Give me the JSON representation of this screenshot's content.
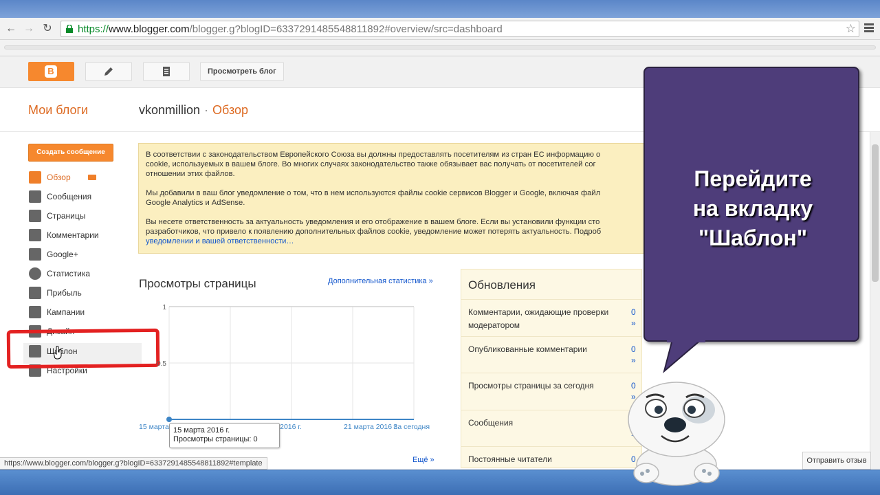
{
  "browser": {
    "url_scheme": "https://",
    "url_host": "www.blogger.com",
    "url_path": "/blogger.g?blogID=6337291485548811892#overview/src=dashboard",
    "back_icon": "arrow-left-icon",
    "forward_icon": "arrow-right-icon",
    "reload_icon": "reload-icon",
    "star_icon": "star-icon"
  },
  "header": {
    "view_blog_label": "Просмотреть блог",
    "my_blogs_label": "Мои блоги",
    "blog_name": "vkonmillion",
    "separator": "·",
    "section": "Обзор"
  },
  "sidebar": {
    "create_post_label": "Создать сообщение",
    "items": [
      {
        "label": "Обзор",
        "icon": "home-icon"
      },
      {
        "label": "Сообщения",
        "icon": "posts-icon"
      },
      {
        "label": "Страницы",
        "icon": "pages-icon"
      },
      {
        "label": "Комментарии",
        "icon": "comment-icon"
      },
      {
        "label": "Google+",
        "icon": "google-plus-icon"
      },
      {
        "label": "Статистика",
        "icon": "stats-icon"
      },
      {
        "label": "Прибыль",
        "icon": "trophy-icon"
      },
      {
        "label": "Кампании",
        "icon": "campaign-icon"
      },
      {
        "label": "Дизайн",
        "icon": "layout-icon"
      },
      {
        "label": "Шаблон",
        "icon": "template-icon"
      },
      {
        "label": "Настройки",
        "icon": "wrench-icon"
      }
    ]
  },
  "cookie_notice": {
    "p1_line1": "В соответствии с законодательством Европейского Союза вы должны предоставлять посетителям из стран ЕС информацию о",
    "p1_line2": "cookie, используемых в вашем блоге. Во многих случаях законодательство также обязывает вас получать от посетителей сог",
    "p1_line3": "отношении этих файлов.",
    "p2_line1": "Мы добавили в ваш блог уведомление о том, что в нем используются файлы cookie сервисов Blogger и Google, включая файл",
    "p2_line2": "Google Analytics и AdSense.",
    "p3_line1": "Вы несете ответственность за актуальность уведомления и его отображение в вашем блоге. Если вы установили функции сто",
    "p3_line2": "разработчиков, что привело к появлению дополнительных файлов cookie, уведомление может потерять актуальность. Подроб",
    "p3_link": "уведомлении и вашей ответственности…"
  },
  "stats": {
    "title": "Просмотры страницы",
    "more_stats_link": "Дополнительная статистика »",
    "more_link": "Ещё »",
    "tooltip_date": "15 марта 2016 г.",
    "tooltip_value": "Просмотры страницы: 0"
  },
  "chart_data": {
    "type": "line",
    "x": [
      "15 марта 2016 г.",
      "21 марта 2016 г.",
      "За сегодня"
    ],
    "x_ticks": [
      "15 марта 2016 г.",
      "марта 2016 г.",
      "21 марта 2016 г.",
      "За сегодня"
    ],
    "y_ticks": [
      "1",
      "0.5"
    ],
    "ylim": [
      0,
      1
    ],
    "series": [
      {
        "values": [
          0,
          0,
          0,
          0,
          0,
          0,
          0,
          0
        ]
      }
    ],
    "grid": true,
    "line_color": "#3d85c6"
  },
  "updates": {
    "title": "Обновления",
    "rows": [
      {
        "label": "Комментарии, ожидающие проверки модератором",
        "count": "0",
        "arrow": "»"
      },
      {
        "label": "Опубликованные комментарии",
        "count": "0",
        "arrow": "»"
      },
      {
        "label": "Просмотры страницы за сегодня",
        "count": "0",
        "arrow": "»"
      },
      {
        "label": "Сообщения",
        "count": "0",
        "arrow": "»"
      },
      {
        "label": "Постоянные читатели",
        "count": "0",
        "arrow": "»"
      }
    ]
  },
  "status_bar": {
    "url": "https://www.blogger.com/blogger.g?blogID=6337291485548811892#template"
  },
  "feedback_label": "Отправить отзыв",
  "overlay": {
    "line1": "Перейдите",
    "line2": "на вкладку",
    "line3": "\"Шаблон\""
  },
  "colors": {
    "accent": "#f6882e",
    "link": "#1155cc",
    "callout": "#4e3d7a",
    "highlight": "#e32121"
  }
}
